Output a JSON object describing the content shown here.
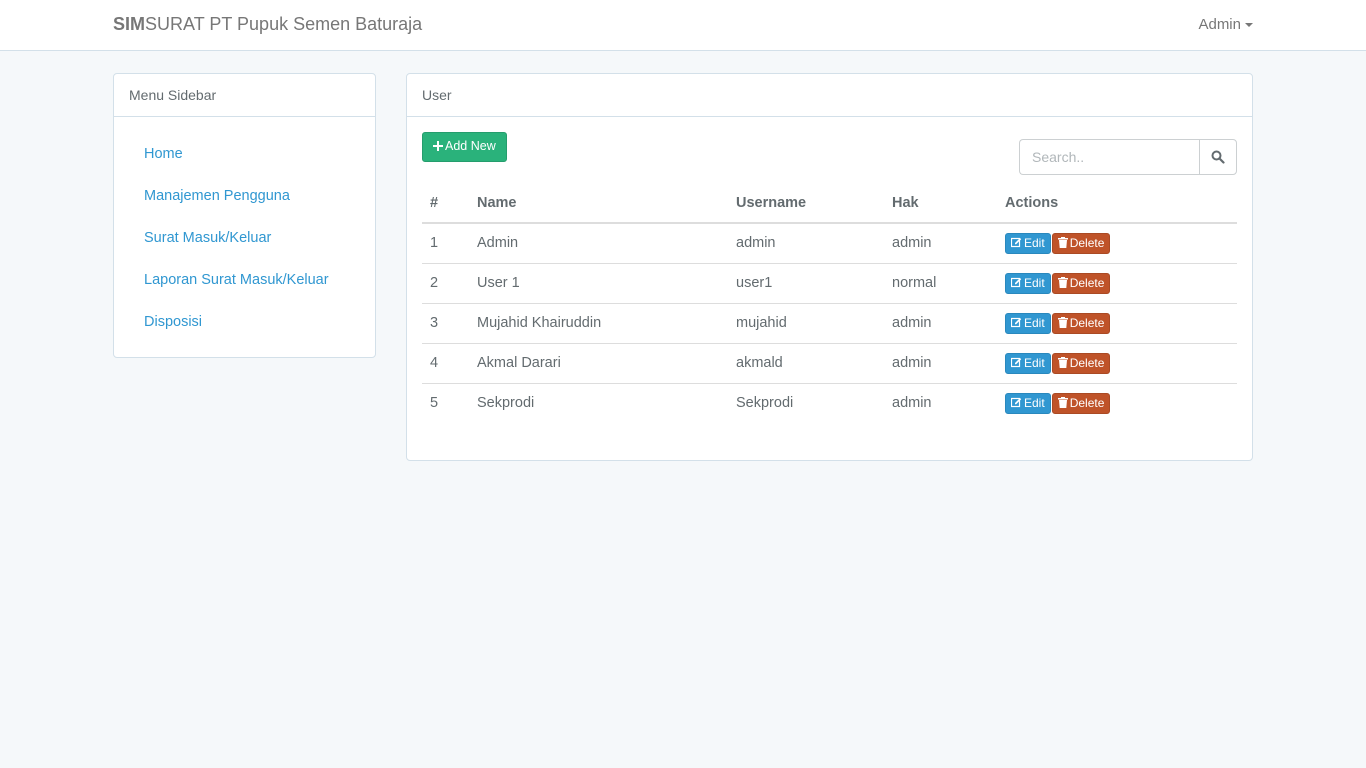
{
  "navbar": {
    "brand_bold": "SIM",
    "brand_rest": "SURAT PT Pupuk Semen Baturaja",
    "user": "Admin"
  },
  "sidebar": {
    "title": "Menu Sidebar",
    "items": [
      {
        "label": "Home"
      },
      {
        "label": "Manajemen Pengguna"
      },
      {
        "label": "Surat Masuk/Keluar"
      },
      {
        "label": "Laporan Surat Masuk/Keluar"
      },
      {
        "label": "Disposisi"
      }
    ]
  },
  "main": {
    "title": "User",
    "add_label": "Add New",
    "search": {
      "placeholder": "Search.."
    },
    "columns": [
      "#",
      "Name",
      "Username",
      "Hak",
      "Actions"
    ],
    "rows": [
      {
        "num": "1",
        "name": "Admin",
        "username": "admin",
        "hak": "admin"
      },
      {
        "num": "2",
        "name": "User 1",
        "username": "user1",
        "hak": "normal"
      },
      {
        "num": "3",
        "name": "Mujahid Khairuddin",
        "username": "mujahid",
        "hak": "admin"
      },
      {
        "num": "4",
        "name": "Akmal Darari",
        "username": "akmald",
        "hak": "admin"
      },
      {
        "num": "5",
        "name": "Sekprodi",
        "username": "Sekprodi",
        "hak": "admin"
      }
    ],
    "edit_label": "Edit",
    "delete_label": "Delete"
  },
  "colors": {
    "primary": "#3097d1",
    "success": "#2ab27b",
    "danger": "#bf5329",
    "background": "#f5f8fa"
  }
}
